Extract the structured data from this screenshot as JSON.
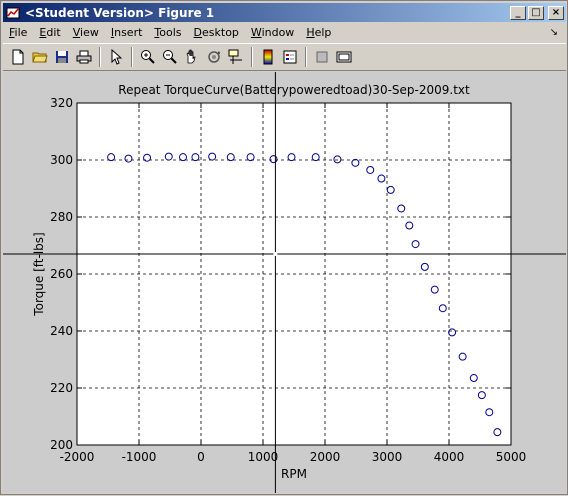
{
  "window": {
    "title": "<Student Version> Figure 1",
    "minimize_glyph": "_",
    "maximize_glyph": "□",
    "close_glyph": "×"
  },
  "menubar": {
    "items": [
      {
        "label": "File",
        "accel": "F",
        "rest": "ile"
      },
      {
        "label": "Edit",
        "accel": "E",
        "rest": "dit"
      },
      {
        "label": "View",
        "accel": "V",
        "rest": "iew"
      },
      {
        "label": "Insert",
        "accel": "I",
        "rest": "nsert"
      },
      {
        "label": "Tools",
        "accel": "T",
        "rest": "ools"
      },
      {
        "label": "Desktop",
        "accel": "D",
        "rest": "esktop"
      },
      {
        "label": "Window",
        "accel": "W",
        "rest": "indow"
      },
      {
        "label": "Help",
        "accel": "H",
        "rest": "elp"
      }
    ],
    "dock_glyph": "↘"
  },
  "toolbar": {
    "icons": [
      "new-file-icon",
      "open-folder-icon",
      "save-icon",
      "print-icon",
      "edit-plot-icon",
      "zoom-in-icon",
      "zoom-out-icon",
      "pan-icon",
      "rotate-3d-icon",
      "data-cursor-icon",
      "insert-colorbar-icon",
      "insert-legend-icon",
      "hide-plot-tools-icon",
      "show-plot-tools-icon"
    ]
  },
  "chart_data": {
    "type": "scatter",
    "title": "Repeat TorqueCurve(Batterypoweredtoad)30-Sep-2009.txt",
    "xlabel": "RPM",
    "ylabel": "Torque [ft-lbs]",
    "xlim": [
      -2000,
      5000
    ],
    "ylim": [
      200,
      320
    ],
    "xticks": [
      -2000,
      -1000,
      0,
      1000,
      2000,
      3000,
      4000,
      5000
    ],
    "yticks": [
      200,
      220,
      240,
      260,
      280,
      300,
      320
    ],
    "grid": true,
    "marker": "circle",
    "marker_color": "#00008b",
    "crosshair": {
      "x": 1200,
      "y": 267
    },
    "points": [
      {
        "x": -1450,
        "y": 301.0
      },
      {
        "x": -1170,
        "y": 300.5
      },
      {
        "x": -870,
        "y": 300.8
      },
      {
        "x": -520,
        "y": 301.2
      },
      {
        "x": -290,
        "y": 301.0
      },
      {
        "x": -90,
        "y": 301.0
      },
      {
        "x": 180,
        "y": 301.2
      },
      {
        "x": 480,
        "y": 301.0
      },
      {
        "x": 800,
        "y": 301.0
      },
      {
        "x": 1170,
        "y": 300.3
      },
      {
        "x": 1460,
        "y": 301.0
      },
      {
        "x": 1850,
        "y": 301.0
      },
      {
        "x": 2200,
        "y": 300.2
      },
      {
        "x": 2490,
        "y": 299.0
      },
      {
        "x": 2730,
        "y": 296.5
      },
      {
        "x": 2910,
        "y": 293.5
      },
      {
        "x": 3060,
        "y": 289.5
      },
      {
        "x": 3230,
        "y": 283.0
      },
      {
        "x": 3360,
        "y": 277.0
      },
      {
        "x": 3460,
        "y": 270.5
      },
      {
        "x": 3610,
        "y": 262.5
      },
      {
        "x": 3770,
        "y": 254.5
      },
      {
        "x": 3900,
        "y": 248.0
      },
      {
        "x": 4050,
        "y": 239.5
      },
      {
        "x": 4220,
        "y": 231.0
      },
      {
        "x": 4400,
        "y": 223.5
      },
      {
        "x": 4530,
        "y": 217.5
      },
      {
        "x": 4650,
        "y": 211.5
      },
      {
        "x": 4780,
        "y": 204.5
      }
    ]
  }
}
